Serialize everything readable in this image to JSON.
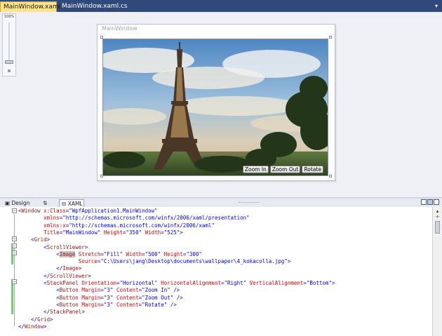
{
  "tabs": [
    {
      "label": "MainWindow.xaml",
      "active": true
    },
    {
      "label": "MainWindow.xaml.cs",
      "active": false
    }
  ],
  "zoom": {
    "label": "100%"
  },
  "window": {
    "title": "MainWindow",
    "buttons": [
      "Zoom In",
      "Zoom Out",
      "Rotate"
    ]
  },
  "view_tabs": {
    "design": "Design",
    "swap": "⇅",
    "xaml": "XAML"
  },
  "code": {
    "lines": [
      "<Window x:Class=\"WpfApplication1.MainWindow\"",
      "        xmlns=\"http://schemas.microsoft.com/winfx/2006/xaml/presentation\"",
      "        xmlns:x=\"http://schemas.microsoft.com/winfx/2006/xaml\"",
      "        Title=\"MainWindow\" Height=\"350\" Width=\"525\">",
      "    <Grid>",
      "        <ScrollViewer>",
      "            <Image Stretch=\"Fill\" Width=\"500\" Height=\"300\"",
      "                   Source=\"C:\\Users\\jang\\Desktop\\documents\\wallpaper\\4_kokacolla.jpg\">",
      "            </Image>",
      "        </ScrollViewer>",
      "        <StackPanel Orientation=\"Horizontal\" HorizontalAlignment=\"Right\" VerticalAlignment=\"Bottom\">",
      "            <Button Margin=\"3\" Content=\"Zoom In\" />",
      "            <Button Margin=\"3\" Content=\"Zoom Out\" />",
      "            <Button Margin=\"3\" Content=\"Rotate\" />",
      "        </StackPanel>",
      "    </Grid>",
      "</Window>"
    ]
  },
  "colors": {
    "tabbar": "#2f4a7a",
    "active_tab": "#fde38c",
    "xml_tag": "#a31515",
    "xml_attr": "#e00000",
    "xml_value": "#0000ff",
    "change_bar": "#6fd16f"
  }
}
